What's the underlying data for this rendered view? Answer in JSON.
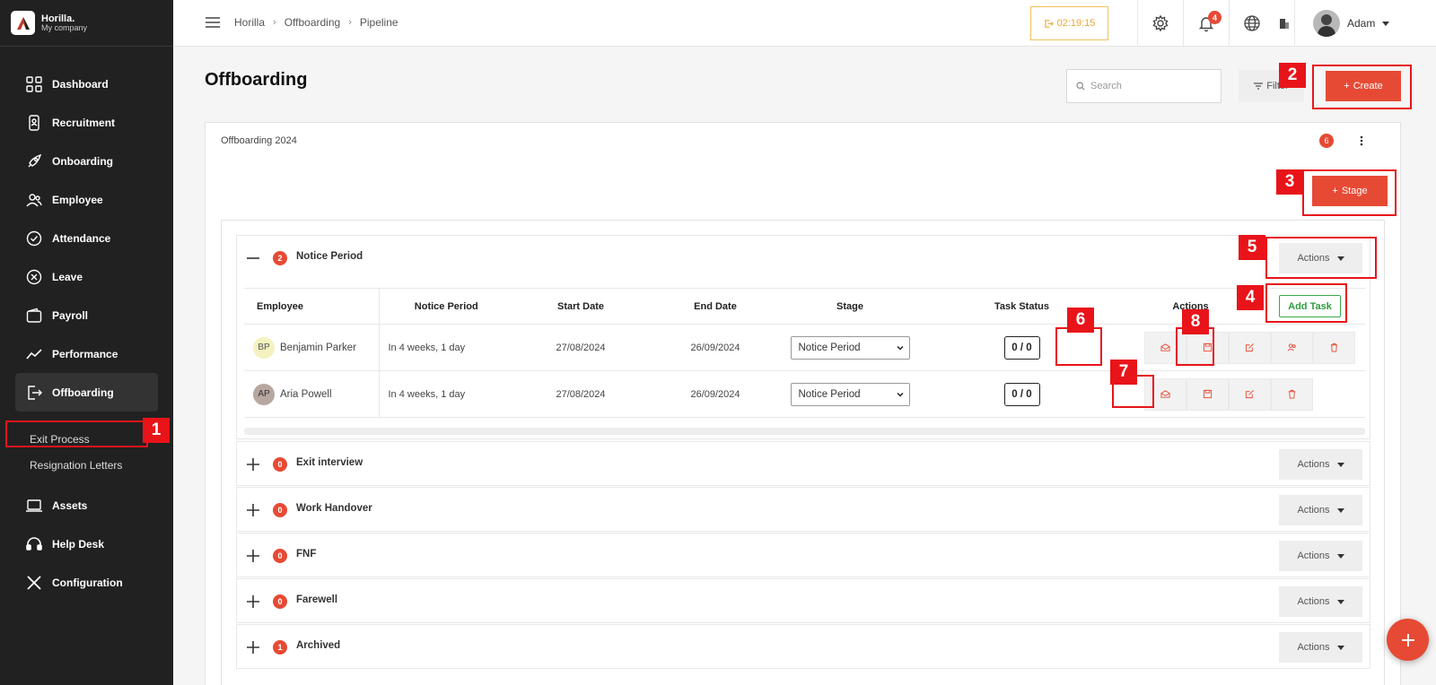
{
  "brand": {
    "name": "Horilla.",
    "subtitle": "My company"
  },
  "sidebar": {
    "items": [
      {
        "label": "Dashboard"
      },
      {
        "label": "Recruitment"
      },
      {
        "label": "Onboarding"
      },
      {
        "label": "Employee"
      },
      {
        "label": "Attendance"
      },
      {
        "label": "Leave"
      },
      {
        "label": "Payroll"
      },
      {
        "label": "Performance"
      },
      {
        "label": "Offboarding"
      }
    ],
    "subitems": [
      {
        "label": "Exit Process"
      },
      {
        "label": "Resignation Letters"
      }
    ],
    "items_after": [
      {
        "label": "Assets"
      },
      {
        "label": "Help Desk"
      },
      {
        "label": "Configuration"
      }
    ]
  },
  "topbar": {
    "breadcrumb": [
      "Horilla",
      "Offboarding",
      "Pipeline"
    ],
    "timer": "02:19:15",
    "notification_count": "4",
    "user_name": "Adam"
  },
  "page": {
    "title": "Offboarding",
    "search_placeholder": "Search",
    "filter_label": "Filter",
    "create_label": "Create"
  },
  "pipeline": {
    "title": "Offboarding 2024",
    "count": "6",
    "stage_button": "Stage",
    "actions_label": "Actions",
    "add_task_label": "Add Task",
    "columns": [
      "Employee",
      "Notice Period",
      "Start Date",
      "End Date",
      "Stage",
      "Task Status",
      "Actions"
    ],
    "open_stage": {
      "count": "2",
      "name": "Notice Period"
    },
    "rows": [
      {
        "initials": "BP",
        "name": "Benjamin Parker",
        "notice": "In 4 weeks, 1 day",
        "start": "27/08/2024",
        "end": "26/09/2024",
        "stage": "Notice Period",
        "task_status": "0 / 0"
      },
      {
        "initials": "AP",
        "name": "Aria Powell",
        "notice": "In 4 weeks, 1 day",
        "start": "27/08/2024",
        "end": "26/09/2024",
        "stage": "Notice Period",
        "task_status": "0 / 0"
      }
    ],
    "stages": [
      {
        "count": "0",
        "name": "Exit interview"
      },
      {
        "count": "0",
        "name": "Work Handover"
      },
      {
        "count": "0",
        "name": "FNF"
      },
      {
        "count": "0",
        "name": "Farewell"
      },
      {
        "count": "1",
        "name": "Archived"
      }
    ]
  },
  "annotations": [
    "1",
    "2",
    "3",
    "4",
    "5",
    "6",
    "7",
    "8"
  ],
  "colors": {
    "accent": "#e64a35",
    "annotation": "#e8141a",
    "sidebar": "#212121",
    "success": "#2e9c3f"
  }
}
